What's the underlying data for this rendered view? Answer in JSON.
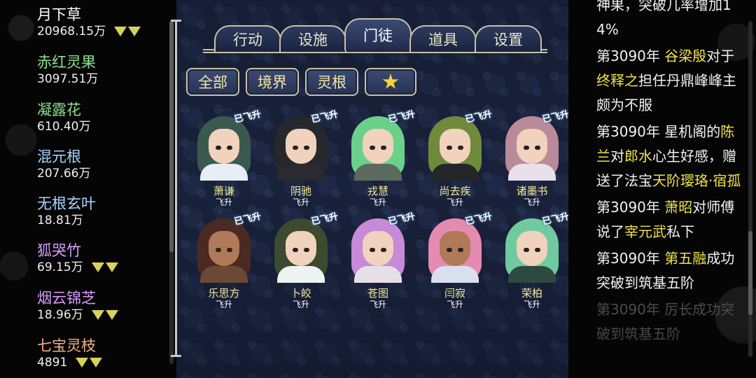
{
  "resources": [
    {
      "name": "月下草",
      "amount": "20968.15万",
      "color": "#ffffff",
      "indicator": true
    },
    {
      "name": "赤红灵果",
      "amount": "3097.51万",
      "color": "#8ee08e",
      "indicator": false
    },
    {
      "name": "凝露花",
      "amount": "610.40万",
      "color": "#8ee08e",
      "indicator": false
    },
    {
      "name": "混元根",
      "amount": "207.66万",
      "color": "#aad4ff",
      "indicator": false
    },
    {
      "name": "无根玄叶",
      "amount": "18.81万",
      "color": "#aad4ff",
      "indicator": false
    },
    {
      "name": "狐哭竹",
      "amount": "69.15万",
      "color": "#d99cff",
      "indicator": true
    },
    {
      "name": "烟云锦芝",
      "amount": "18.96万",
      "color": "#d99cff",
      "indicator": true
    },
    {
      "name": "七宝灵枝",
      "amount": "4891",
      "color": "#f2b08a",
      "indicator": true
    }
  ],
  "tabs": [
    {
      "label": "行动",
      "active": false
    },
    {
      "label": "设施",
      "active": false
    },
    {
      "label": "门徒",
      "active": true
    },
    {
      "label": "道具",
      "active": false
    },
    {
      "label": "设置",
      "active": false
    }
  ],
  "filters": [
    {
      "label": "全部"
    },
    {
      "label": "境界"
    },
    {
      "label": "灵根"
    },
    {
      "label": "",
      "icon": "star-icon"
    }
  ],
  "disciples": [
    {
      "name": "萧谦",
      "status": "飞升",
      "badge": "已飞升",
      "hair": "#3a5a4f",
      "robe": "#e8eef6",
      "skin": "light"
    },
    {
      "name": "阴驰",
      "status": "飞升",
      "badge": "已飞升",
      "hair": "#26282c",
      "robe": "#2a2a30",
      "skin": "light"
    },
    {
      "name": "戎慧",
      "status": "飞升",
      "badge": "已飞升",
      "hair": "#6ad08a",
      "robe": "#5c6a5e",
      "skin": "light"
    },
    {
      "name": "尚去疾",
      "status": "飞升",
      "badge": "已飞升",
      "hair": "#6f8a3a",
      "robe": "#24262a",
      "skin": "light"
    },
    {
      "name": "诸墨书",
      "status": "飞升",
      "badge": "已飞升",
      "hair": "#b88a9a",
      "robe": "#e8e0ea",
      "skin": "light"
    },
    {
      "name": "乐思方",
      "status": "飞升",
      "badge": "已飞升",
      "hair": "#4a2a22",
      "robe": "#6a4a36",
      "skin": "dark"
    },
    {
      "name": "卜皎",
      "status": "飞升",
      "badge": "已飞升",
      "hair": "#3c4a30",
      "robe": "#eef2f0",
      "skin": "light"
    },
    {
      "name": "苍图",
      "status": "飞升",
      "badge": "已飞升",
      "hair": "#c68ad8",
      "robe": "#e6dfe8",
      "skin": "light"
    },
    {
      "name": "闫寂",
      "status": "飞升",
      "badge": "已飞升",
      "hair": "#e58ab0",
      "robe": "#d8e0f0",
      "skin": "dark"
    },
    {
      "name": "荣柏",
      "status": "飞升",
      "badge": "已飞升",
      "hair": "#6fcaa0",
      "robe": "#2e4a40",
      "skin": "light"
    }
  ],
  "log": [
    {
      "segments": [
        {
          "t": "神果，突破几率增加14%",
          "hl": false
        }
      ],
      "faded": false
    },
    {
      "segments": [
        {
          "t": "第3090年 ",
          "hl": false
        },
        {
          "t": "谷梁殷",
          "hl": true
        },
        {
          "t": "对于",
          "hl": false
        },
        {
          "t": "终释之",
          "hl": true
        },
        {
          "t": "担任丹鼎峰峰主颇为不服",
          "hl": false
        }
      ],
      "faded": false
    },
    {
      "segments": [
        {
          "t": "第3090年 星机阁的",
          "hl": false
        },
        {
          "t": "陈兰",
          "hl": true
        },
        {
          "t": "对",
          "hl": false
        },
        {
          "t": "郎水",
          "hl": true
        },
        {
          "t": "心生好感，赠送了法宝",
          "hl": false
        },
        {
          "t": "天阶璎珞·宿孤",
          "hl": true
        }
      ],
      "faded": false
    },
    {
      "segments": [
        {
          "t": "第3090年 ",
          "hl": false
        },
        {
          "t": "萧昭",
          "hl": true
        },
        {
          "t": "对师傅说了",
          "hl": false
        },
        {
          "t": "宰元武",
          "hl": true
        },
        {
          "t": "私下",
          "hl": false
        }
      ],
      "faded": false
    },
    {
      "segments": [
        {
          "t": "第3090年 ",
          "hl": false
        },
        {
          "t": "第五融",
          "hl": true
        },
        {
          "t": "成功突破到筑基五阶",
          "hl": false
        }
      ],
      "faded": false
    },
    {
      "segments": [
        {
          "t": "第3090年 厉长成功突破到筑基五阶",
          "hl": false
        }
      ],
      "faded": true
    }
  ]
}
